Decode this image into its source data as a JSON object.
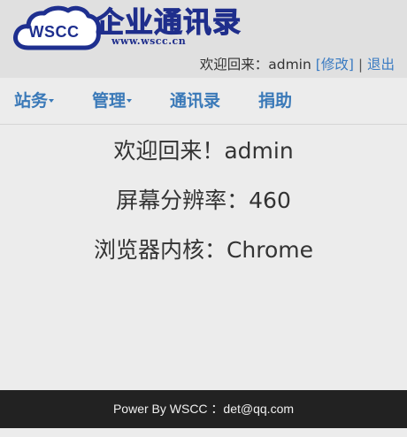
{
  "brand": {
    "cloud_text": "WSCC",
    "title": "企业通讯录",
    "url": "www.wscc.cn",
    "color": "#1f2e8c"
  },
  "userbar": {
    "welcome": "欢迎回来：",
    "username": "admin",
    "edit_link": "[修改]",
    "separator": "|",
    "logout_link": "退出"
  },
  "nav": {
    "items": [
      {
        "label": "站务",
        "has_dropdown": true
      },
      {
        "label": "管理",
        "has_dropdown": true
      },
      {
        "label": "通讯录",
        "has_dropdown": false
      },
      {
        "label": "捐助",
        "has_dropdown": false
      }
    ],
    "link_color": "#3a79b8"
  },
  "main": {
    "welcome_line": "欢迎回来！admin",
    "resolution_line": "屏幕分辨率：460",
    "browser_line": "浏览器内核：Chrome"
  },
  "footer": {
    "text": "Power By WSCC ：det@qq.com"
  }
}
